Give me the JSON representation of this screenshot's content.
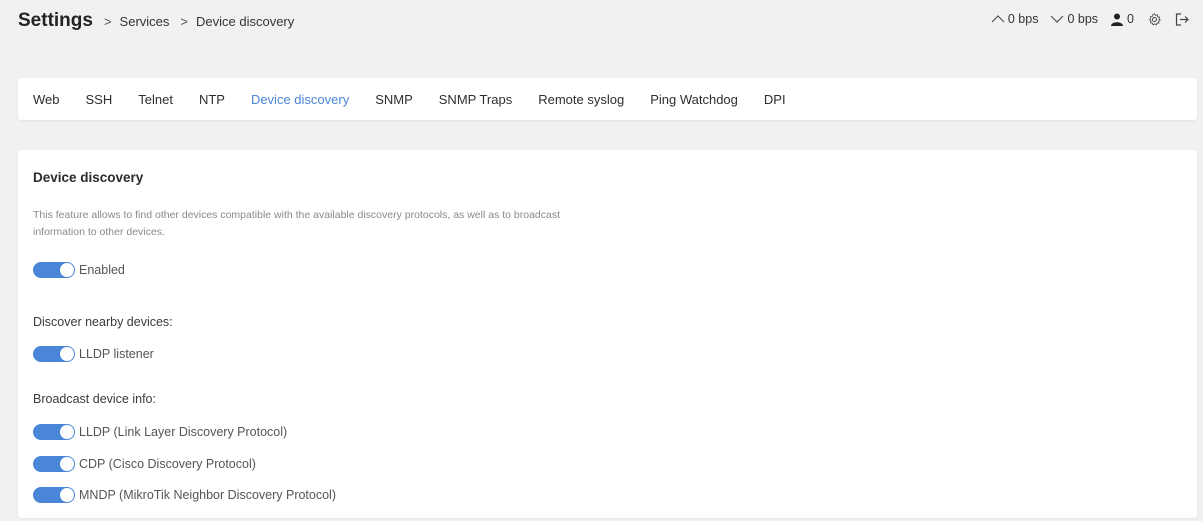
{
  "header": {
    "title": "Settings",
    "breadcrumbs": [
      "Services",
      "Device discovery"
    ],
    "status": {
      "upload": "0 bps",
      "download": "0 bps",
      "users": "0"
    },
    "icons": [
      "chevron-up-icon",
      "chevron-down-icon",
      "user-icon",
      "gear-icon",
      "logout-icon"
    ]
  },
  "tabs": [
    {
      "label": "Web",
      "active": false
    },
    {
      "label": "SSH",
      "active": false
    },
    {
      "label": "Telnet",
      "active": false
    },
    {
      "label": "NTP",
      "active": false
    },
    {
      "label": "Device discovery",
      "active": true
    },
    {
      "label": "SNMP",
      "active": false
    },
    {
      "label": "SNMP Traps",
      "active": false
    },
    {
      "label": "Remote syslog",
      "active": false
    },
    {
      "label": "Ping Watchdog",
      "active": false
    },
    {
      "label": "DPI",
      "active": false
    }
  ],
  "main": {
    "title": "Device discovery",
    "description": "This feature allows to find other devices compatible with the available discovery protocols, as well as to broadcast information to other devices.",
    "enabled": {
      "label": "Enabled",
      "on": true
    },
    "discover_label": "Discover nearby devices:",
    "lldp_listener": {
      "label": "LLDP listener",
      "on": true
    },
    "broadcast_label": "Broadcast device info:",
    "lldp": {
      "label": "LLDP (Link Layer Discovery Protocol)",
      "on": true
    },
    "cdp": {
      "label": "CDP (Cisco Discovery Protocol)",
      "on": true
    },
    "mndp": {
      "label": "MNDP (MikroTik Neighbor Discovery Protocol)",
      "on": true
    }
  },
  "colors": {
    "accent": "#4a86d8",
    "background": "#f1f1f2",
    "card": "#ffffff"
  }
}
